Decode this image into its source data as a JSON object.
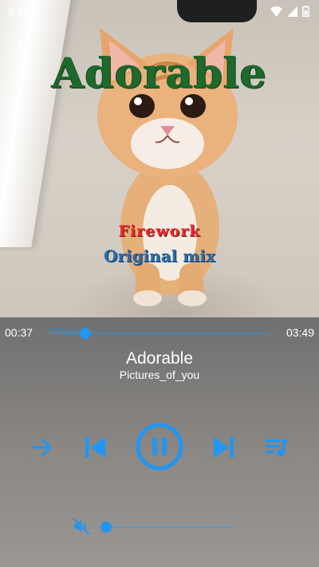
{
  "status_bar": {
    "time": "9:45"
  },
  "artwork": {
    "title_text": "Adorable",
    "label_line1": "Firework",
    "label_line2": "Original mix"
  },
  "player": {
    "elapsed": "00:37",
    "duration": "03:49",
    "progress": 0.163,
    "track_title": "Adorable",
    "track_artist": "Pictures_of_you",
    "state": "playing",
    "volume": 0.0,
    "muted": true
  },
  "icons": {
    "collapse": "chevron-down-icon",
    "repeat_mode": "arrow-right-icon",
    "previous": "skip-previous-icon",
    "pause": "pause-circle-icon",
    "next": "skip-next-icon",
    "queue": "queue-music-icon",
    "mute": "volume-off-icon"
  },
  "colors": {
    "accent": "#2196f3",
    "text": "#ffffff"
  }
}
